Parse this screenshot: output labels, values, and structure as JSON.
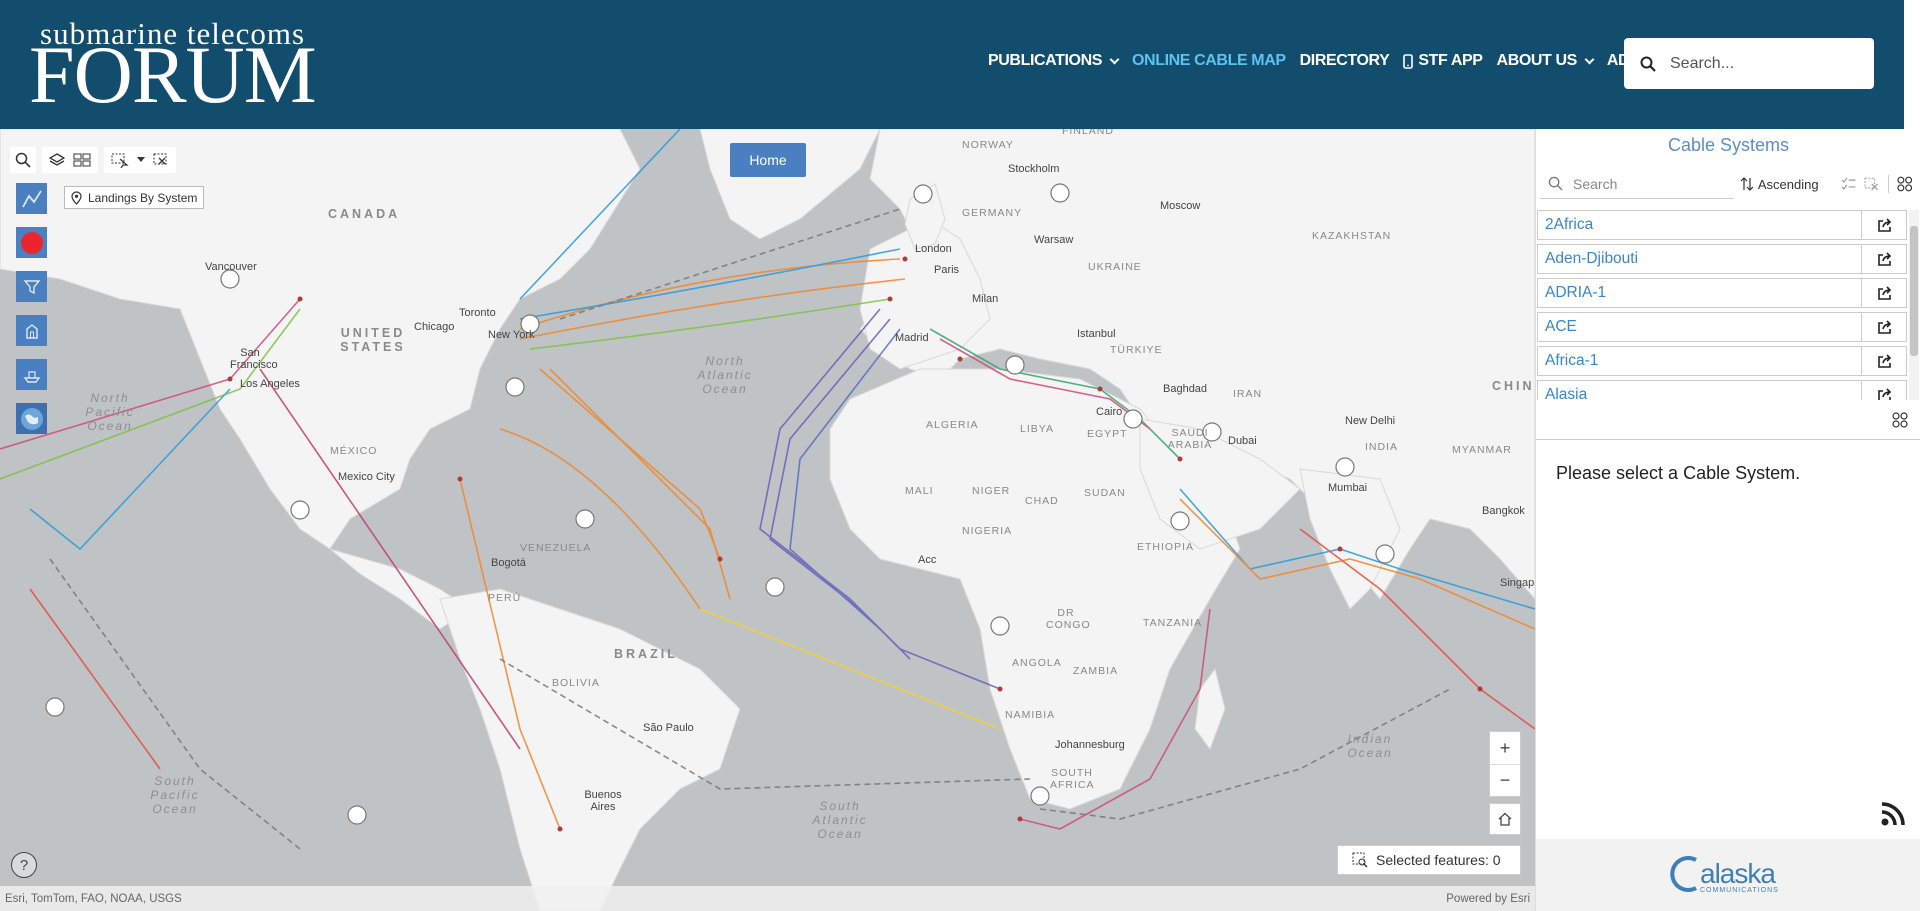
{
  "header": {
    "logo_top": "submarine telecoms",
    "logo_main": "FORUM",
    "nav": [
      {
        "label": "PUBLICATIONS",
        "dropdown": true
      },
      {
        "label": "ONLINE CABLE MAP",
        "dropdown": false,
        "active": true
      },
      {
        "label": "DIRECTORY",
        "dropdown": false
      },
      {
        "label": "STF APP",
        "dropdown": false,
        "icon": "phone-icon"
      },
      {
        "label": "ABOUT US",
        "dropdown": true
      },
      {
        "label": "ADVERTISING",
        "dropdown": false
      }
    ],
    "search_placeholder": "Search..."
  },
  "map": {
    "home_button": "Home",
    "landings_label": "Landings By System",
    "selected_features": "Selected features: 0",
    "attribution_left": "Esri, TomTom, FAO, NOAA, USGS",
    "attribution_right": "Powered by Esri",
    "labels": {
      "canada": "CANADA",
      "united_states": "UNITED STATES",
      "mexico": "MÉXICO",
      "venezuela": "VENEZUELA",
      "peru": "PERÚ",
      "bolivia": "BOLIVIA",
      "brazil": "BRAZIL",
      "algeria": "ALGERIA",
      "libya": "LIBYA",
      "egypt": "EGYPT",
      "mali": "MALI",
      "niger": "NIGER",
      "chad": "CHAD",
      "sudan": "SUDAN",
      "nigeria": "NIGERIA",
      "ethiopia": "ETHIOPIA",
      "dr_congo": "DR CONGO",
      "angola": "ANGOLA",
      "zambia": "ZAMBIA",
      "tanzania": "TANZANIA",
      "namibia": "NAMIBIA",
      "south_africa": "SOUTH AFRICA",
      "ukraine": "UKRAINE",
      "kazakhstan": "KAZAKHSTAN",
      "turkiye": "TÜRKIYE",
      "iran": "IRAN",
      "saudi_arabia": "SAUDI ARABIA",
      "india": "INDIA",
      "myanmar": "MYANMAR",
      "china": "CHIN",
      "finland": "FINLAND",
      "norway": "NORWAY",
      "germany": "GERMANY",
      "vancouver": "Vancouver",
      "san_francisco": "San Francisco",
      "los_angeles": "Los Angeles",
      "chicago": "Chicago",
      "toronto": "Toronto",
      "new_york": "New York",
      "mexico_city": "Mexico City",
      "bogota": "Bogotá",
      "sao_paulo": "São Paulo",
      "buenos_aires": "Buenos Aires",
      "london": "London",
      "paris": "Paris",
      "madrid": "Madrid",
      "milan": "Milan",
      "istanbul": "Istanbul",
      "moscow": "Moscow",
      "warsaw": "Warsaw",
      "stockholm": "Stockholm",
      "cairo": "Cairo",
      "baghdad": "Baghdad",
      "dubai": "Dubai",
      "new_delhi": "New Delhi",
      "mumbai": "Mumbai",
      "bangkok": "Bangkok",
      "singapore": "Singap",
      "johannesburg": "Johannesburg",
      "accra": "Acc",
      "north_pacific": "North Pacific Ocean",
      "north_atlantic": "North Atlantic Ocean",
      "south_atlantic": "South Atlantic Ocean",
      "south_pacific": "South Pacific Ocean",
      "indian_ocean": "Indian Ocean"
    }
  },
  "panel": {
    "title": "Cable Systems",
    "search_placeholder": "Search",
    "sort_label": "Ascending",
    "items": [
      "2Africa",
      "Aden-Djibouti",
      "ADRIA-1",
      "ACE",
      "Africa-1",
      "Alasia"
    ],
    "empty_message": "Please select a Cable System.",
    "sponsor": "alaska",
    "sponsor_sub": "COMMUNICATIONS"
  },
  "colors": {
    "header_bg": "#134d6e",
    "nav_active": "#5cc2ee",
    "accent_blue": "#4a7fc1",
    "list_link": "#3a86c8"
  }
}
